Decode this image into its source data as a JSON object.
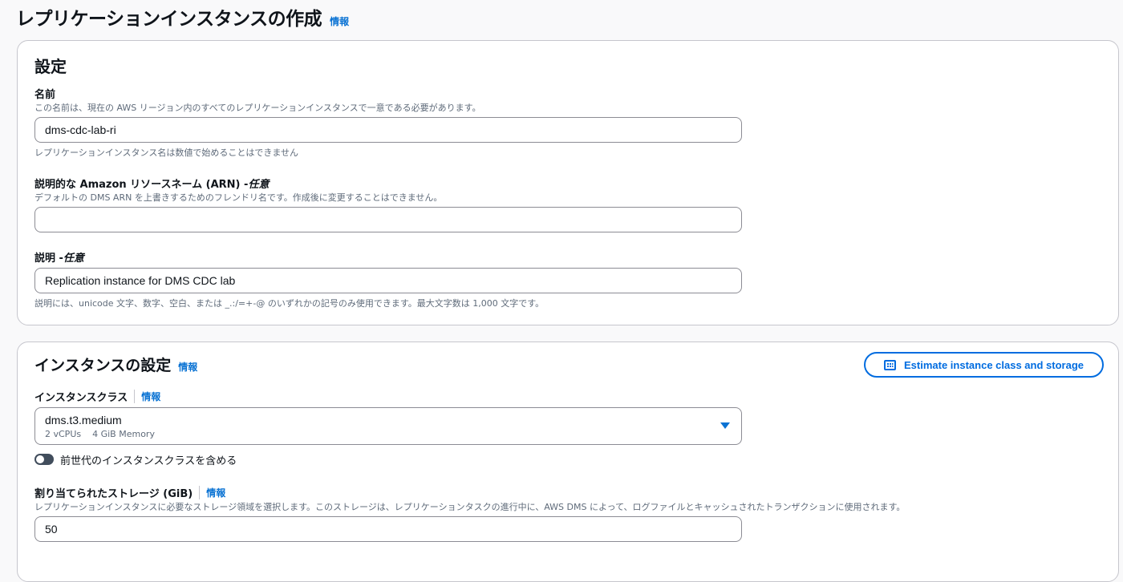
{
  "page": {
    "title": "レプリケーションインスタンスの作成",
    "info": "情報"
  },
  "settings": {
    "heading": "設定",
    "name": {
      "label": "名前",
      "description": "この名前は、現在の AWS リージョン内のすべてのレプリケーションインスタンスで一意である必要があります。",
      "value": "dms-cdc-lab-ri",
      "hint": "レプリケーションインスタンス名は数値で始めることはできません"
    },
    "arn": {
      "label": "説明的な Amazon リソースネーム (ARN) - ",
      "optional": "任意",
      "description": "デフォルトの DMS ARN を上書きするためのフレンドリ名です。作成後に変更することはできません。",
      "value": ""
    },
    "description": {
      "label": "説明 - ",
      "optional": "任意",
      "value": "Replication instance for DMS CDC lab",
      "hint": "説明には、unicode 文字、数字、空白、または _.:/=+-@ のいずれかの記号のみ使用できます。最大文字数は 1,000 文字です。"
    }
  },
  "instance": {
    "heading": "インスタンスの設定",
    "info": "情報",
    "estimate_button": "Estimate instance class and storage",
    "estimate_icon": "calculator-icon",
    "class": {
      "label": "インスタンスクラス",
      "info": "情報",
      "selected": "dms.t3.medium",
      "vcpus": "2 vCPUs",
      "memory": "4 GiB Memory"
    },
    "previous_gen": {
      "label": "前世代のインスタンスクラスを含める",
      "checked": false
    },
    "storage": {
      "label": "割り当てられたストレージ (GiB)",
      "info": "情報",
      "description": "レプリケーションインスタンスに必要なストレージ領域を選択します。このストレージは、レプリケーションタスクの進行中に、AWS DMS によって、ログファイルとキャッシュされたトランザクションに使用されます。",
      "value": "50"
    }
  },
  "colors": {
    "link": "#0972d3",
    "button_border": "#006ce0",
    "toggle_off": "#414d5c"
  }
}
